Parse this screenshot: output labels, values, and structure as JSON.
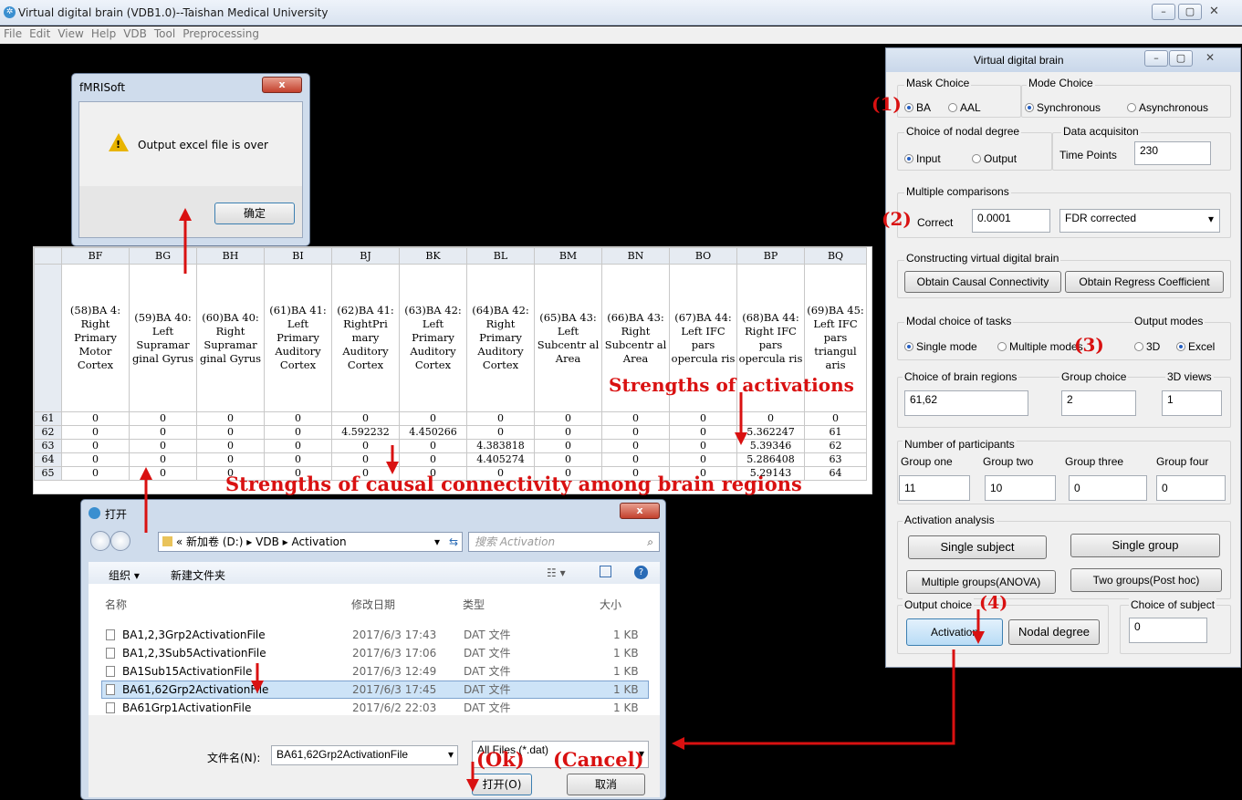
{
  "main_window": {
    "title": "Virtual digital brain (VDB1.0)--Taishan Medical University",
    "menu": [
      "File",
      "Edit",
      "View",
      "Help",
      "VDB",
      "Tool",
      "Preprocessing"
    ]
  },
  "msgbox": {
    "title": "fMRISoft",
    "message": "Output excel file is over",
    "ok_label": "确定",
    "close_label": "x"
  },
  "sheet": {
    "columns": [
      "BF",
      "BG",
      "BH",
      "BI",
      "BJ",
      "BK",
      "BL",
      "BM",
      "BN",
      "BO",
      "BP",
      "BQ"
    ],
    "headers": [
      "(58)BA 4: Right Primary Motor Cortex",
      "(59)BA 40: Left Supramar ginal Gyrus",
      "(60)BA 40: Right Supramar ginal Gyrus",
      "(61)BA 41: Left Primary Auditory Cortex",
      "(62)BA 41: RightPri mary Auditory Cortex",
      "(63)BA 42: Left Primary Auditory Cortex",
      "(64)BA 42: Right Primary Auditory Cortex",
      "(65)BA 43: Left Subcentr al Area",
      "(66)BA 43: Right Subcentr al Area",
      "(67)BA 44: Left IFC pars opercula ris",
      "(68)BA 44: Right IFC pars opercula ris",
      "(69)BA 45: Left IFC pars triangul aris"
    ],
    "rows": [
      {
        "num": "61",
        "cells": [
          "0",
          "0",
          "0",
          "0",
          "0",
          "0",
          "0",
          "0",
          "0",
          "0",
          "0",
          "0"
        ]
      },
      {
        "num": "62",
        "cells": [
          "0",
          "0",
          "0",
          "0",
          "4.592232",
          "4.450266",
          "0",
          "0",
          "0",
          "0",
          "5.362247",
          "61"
        ]
      },
      {
        "num": "63",
        "cells": [
          "0",
          "0",
          "0",
          "0",
          "0",
          "0",
          "4.383818",
          "0",
          "0",
          "0",
          "5.39346",
          "62"
        ]
      },
      {
        "num": "64",
        "cells": [
          "0",
          "0",
          "0",
          "0",
          "0",
          "0",
          "4.405274",
          "0",
          "0",
          "0",
          "5.286408",
          "63"
        ]
      },
      {
        "num": "65",
        "cells": [
          "0",
          "0",
          "0",
          "0",
          "0",
          "0",
          "0",
          "0",
          "0",
          "0",
          "5.29143",
          "64"
        ]
      }
    ]
  },
  "annotations": {
    "activations": "Strengths of activations",
    "causal": "Strengths of causal connectivity among brain regions",
    "ok": "(Ok)",
    "cancel": "(Cancel)",
    "n1": "(1)",
    "n2": "(2)",
    "n3": "(3)",
    "n4": "(4)"
  },
  "open_dialog": {
    "title": "打开",
    "breadcrumb": [
      "«",
      "新加卷 (D:)",
      "▸",
      "VDB",
      "▸",
      "Activation"
    ],
    "search_placeholder": "搜索 Activation",
    "organize": "组织 ▾",
    "new_folder": "新建文件夹",
    "col_name": "名称",
    "col_date": "修改日期",
    "col_type": "类型",
    "col_size": "大小",
    "files": [
      {
        "name": "BA1,2,3Grp2ActivationFile",
        "date": "2017/6/3 17:43",
        "type": "DAT 文件",
        "size": "1 KB"
      },
      {
        "name": "BA1,2,3Sub5ActivationFile",
        "date": "2017/6/3 17:06",
        "type": "DAT 文件",
        "size": "1 KB"
      },
      {
        "name": "BA1Sub15ActivationFile",
        "date": "2017/6/3 12:49",
        "type": "DAT 文件",
        "size": "1 KB"
      },
      {
        "name": "BA61,62Grp2ActivationFile",
        "date": "2017/6/3 17:45",
        "type": "DAT 文件",
        "size": "1 KB"
      },
      {
        "name": "BA61Grp1ActivationFile",
        "date": "2017/6/2 22:03",
        "type": "DAT 文件",
        "size": "1 KB"
      }
    ],
    "filename_label": "文件名(N):",
    "filename_value": "BA61,62Grp2ActivationFile",
    "filter": "All Files (*.dat)",
    "open_label": "打开(O)",
    "cancel_label": "取消"
  },
  "panel": {
    "title": "Virtual  digital  brain",
    "mask_choice": "Mask Choice",
    "mask_ba": "BA",
    "mask_aal": "AAL",
    "mode_choice": "Mode Choice",
    "mode_sync": "Synchronous",
    "mode_async": "Asynchronous",
    "nodal_degree": "Choice of nodal degree",
    "nodal_input": "Input",
    "nodal_output": "Output",
    "data_acq": "Data acquisiton",
    "time_points_label": "Time Points",
    "time_points_value": "230",
    "multiple_comparisons": "Multiple comparisons",
    "correct_label": "Correct",
    "correct_value": "0.0001",
    "correction_select": "FDR corrected",
    "constructing": "Constructing virtual digital brain",
    "obtain_causal": "Obtain  Causal Connectivity",
    "obtain_regress": "Obtain Regress Coefficient",
    "modal_choice": "Modal choice of tasks",
    "output_modes": "Output modes",
    "single_mode": "Single mode",
    "multiple_modes": "Multiple modes",
    "mode_3d": "3D",
    "mode_excel": "Excel",
    "brain_regions_label": "Choice of brain regions",
    "brain_regions_value": "61,62",
    "group_choice_label": "Group choice",
    "group_choice_value": "2",
    "views_3d_label": "3D views",
    "views_3d_value": "1",
    "participants_label": "Number of participants",
    "group_one_label": "Group one",
    "group_two_label": "Group two",
    "group_three_label": "Group three",
    "group_four_label": "Group four",
    "group_one_value": "11",
    "group_two_value": "10",
    "group_three_value": "0",
    "group_four_value": "0",
    "activation_analysis": "Activation analysis",
    "single_subject": "Single subject",
    "single_group": "Single group",
    "multiple_groups": "Multiple groups(ANOVA)",
    "two_groups": "Two groups(Post hoc)",
    "output_choice": "Output choice",
    "activation_btn": "Activation",
    "nodal_degree_btn": "Nodal degree",
    "choice_subject": "Choice of subject",
    "choice_subject_value": "0"
  },
  "colors": {
    "annotation_red": "#d91111",
    "titlebar": "#d9e3f0",
    "selected_row": "#cde3f7"
  }
}
